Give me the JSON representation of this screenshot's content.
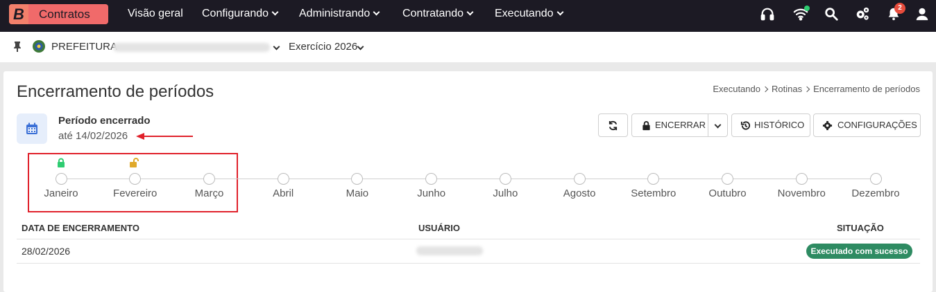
{
  "app": {
    "brand_letter": "B",
    "brand_name": "Contratos",
    "brand_color": "#f06a6a"
  },
  "nav": {
    "items": [
      {
        "label": "Visão geral",
        "dropdown": false
      },
      {
        "label": "Configurando",
        "dropdown": true
      },
      {
        "label": "Administrando",
        "dropdown": true
      },
      {
        "label": "Contratando",
        "dropdown": true
      },
      {
        "label": "Executando",
        "dropdown": true
      }
    ],
    "icons": [
      "headset-icon",
      "wifi-icon",
      "search-icon",
      "cogs-icon",
      "bell-icon",
      "user-icon"
    ],
    "notifications_count": "2"
  },
  "context": {
    "organization": "PREFEITURA",
    "exercise": "Exercício 2026"
  },
  "page": {
    "title": "Encerramento de períodos",
    "breadcrumb": [
      "Executando",
      "Rotinas",
      "Encerramento de períodos"
    ]
  },
  "period": {
    "label": "Período encerrado",
    "date": "até 14/02/2026"
  },
  "toolbar": {
    "encerrar": "ENCERRAR",
    "historico": "HISTÓRICO",
    "configuracoes": "CONFIGURAÇÕES"
  },
  "timeline": {
    "months": [
      "Janeiro",
      "Fevereiro",
      "Março",
      "Abril",
      "Maio",
      "Junho",
      "Julho",
      "Agosto",
      "Setembro",
      "Outubro",
      "Novembro",
      "Dezembro"
    ],
    "locks": [
      {
        "month": "Janeiro",
        "state": "locked",
        "color": "#2ecc71"
      },
      {
        "month": "Fevereiro",
        "state": "unlocked",
        "color": "#e0a92a"
      }
    ]
  },
  "table": {
    "headers": [
      "DATA DE ENCERRAMENTO",
      "USUÁRIO",
      "SITUAÇÃO"
    ],
    "rows": [
      {
        "date": "28/02/2026",
        "status": "Executado com sucesso"
      }
    ],
    "status_color": "#2e8b62"
  }
}
